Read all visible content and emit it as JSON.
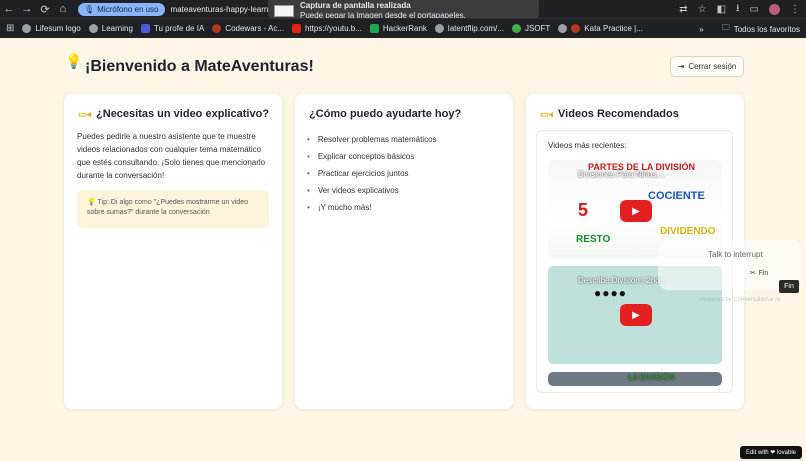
{
  "browser": {
    "mic_pill": "Micrófono en uso",
    "url": "mateaventuras-happy-learning",
    "toast_title": "Captura de pantalla realizada",
    "toast_body": "Puede pegar la imagen desde el portapapeles.",
    "bookmarks": [
      "Lifesum logo",
      "Learning",
      "Tu profe de IA",
      "Codewars - Ac...",
      "https://youtu.b...",
      "HackerRank",
      "latentflip.com/...",
      "JSOFT",
      "Kata Practice |..."
    ],
    "bookmarks_more": "»",
    "folder": "Todos los favoritos"
  },
  "header": {
    "title": "¡Bienvenido a MateAventuras!",
    "logout": "Cerrar sesión"
  },
  "card_video": {
    "title": "¿Necesitas un video explicativo?",
    "text": "Puedes pedirle a nuestro asistente que te muestre videos relacionados con cualquier tema matemático que estés consultando. ¡Solo tienes que mencionarlo durante la conversación!",
    "tip": "💡 Tip: Di algo como \"¿Puedes mostrarme un video sobre sumas?\" durante la conversación"
  },
  "card_help": {
    "title": "¿Cómo puedo ayudarte hoy?",
    "items": [
      "Resolver problemas matemáticos",
      "Explicar conceptos básicos",
      "Practicar ejercicios juntos",
      "Ver videos explicativos",
      "¡Y mucho más!"
    ]
  },
  "card_recommended": {
    "title": "Videos Recomendados",
    "subtitle": "Videos más recientes:",
    "videos": [
      {
        "title": "Divisiones Para Niños,...",
        "words": [
          "PARTES DE LA DIVISIÓN",
          "COCIENTE",
          "RESTO",
          "DIVIDENDO"
        ]
      },
      {
        "title": "Describe Division | 2nd..."
      },
      {
        "title": "LA DIVISIÓN"
      }
    ]
  },
  "voice": {
    "hint": "Talk to interrupt",
    "end_label": "Fin",
    "tooltip": "Fin",
    "powered": "Powered by Conversational AI"
  },
  "lovable": "Edit with ❤ lovable"
}
